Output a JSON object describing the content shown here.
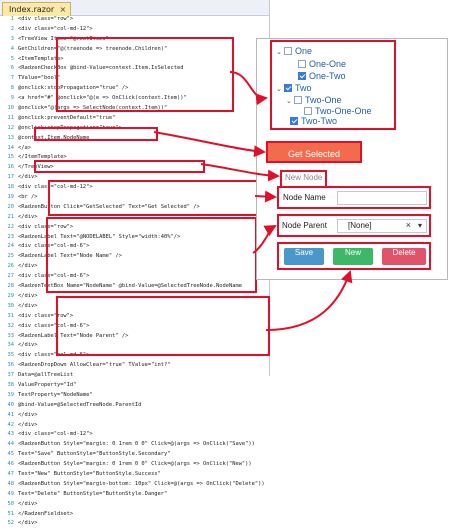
{
  "editor": {
    "tab_title": "Index.razor",
    "lines": [
      {
        "n": "1",
        "t": "<div class=\"row\">"
      },
      {
        "n": "2",
        "t": "  <div class=\"col-md-12\">"
      },
      {
        "n": "3",
        "t": "    <TreeView Items=\"@rootItems\""
      },
      {
        "n": "4",
        "t": "        GetChildren=\"@(treenode => treenode.Children)\""
      },
      {
        "n": "5",
        "t": "        <ItemTemplate>"
      },
      {
        "n": "6",
        "t": "          <RadzenCheckBox @bind-Value=context.Item.IsSelected"
      },
      {
        "n": "7",
        "t": "                          TValue=\"bool\""
      },
      {
        "n": "8",
        "t": "                          @onclick:stopPropagation=\"true\" />"
      },
      {
        "n": "9",
        "t": "          <a href=\"#\" @onclick=\"@(e => OnClick(context.Item))\""
      },
      {
        "n": "10",
        "t": "             @onclick=\"@(args => SelectNode(context.Item))\""
      },
      {
        "n": "11",
        "t": "             @onclick:preventDefault=\"true\""
      },
      {
        "n": "12",
        "t": "             @onclick:stopPropagation=\"true\">"
      },
      {
        "n": "13",
        "t": "            @context.Item.NodeName"
      },
      {
        "n": "14",
        "t": "          </a>"
      },
      {
        "n": "15",
        "t": "        </ItemTemplate>"
      },
      {
        "n": "16",
        "t": "    </TreeView>"
      },
      {
        "n": "17",
        "t": "  </div>"
      },
      {
        "n": "18",
        "t": "  <div class=\"col-md-12\">"
      },
      {
        "n": "19",
        "t": "    <br />"
      },
      {
        "n": "20",
        "t": "    <RadzenButton Click=\"GetSelected\" Text=\"Get Selected\" />"
      },
      {
        "n": "21",
        "t": "  </div>"
      },
      {
        "n": "22",
        "t": "  <div class=\"row\">"
      },
      {
        "n": "23",
        "t": "    <RadzenLabel Text=\"@NODELABEL\" Style=\"width:40%\"/>"
      },
      {
        "n": "24",
        "t": "      <div class=\"col-md-6\">"
      },
      {
        "n": "25",
        "t": "        <RadzenLabel Text=\"Node Name\" />"
      },
      {
        "n": "26",
        "t": "      </div>"
      },
      {
        "n": "27",
        "t": "      <div class=\"col-md-6\">"
      },
      {
        "n": "28",
        "t": "        <RadzenTextBox Name=\"NodeName\" @bind-Value=@SelectedTreeNode.NodeName"
      },
      {
        "n": "29",
        "t": "      </div>"
      },
      {
        "n": "30",
        "t": "    </div>"
      },
      {
        "n": "31",
        "t": "    <div class=\"row\">"
      },
      {
        "n": "32",
        "t": "      <div class=\"col-md-6\">"
      },
      {
        "n": "33",
        "t": "        <RadzenLabel Text=\"Node Parent\" />"
      },
      {
        "n": "34",
        "t": "      </div>"
      },
      {
        "n": "35",
        "t": "      <div class=\"col-md-6\">"
      },
      {
        "n": "36",
        "t": "        <RadzenDropDown AllowClear=\"true\" TValue=\"int?\""
      },
      {
        "n": "37",
        "t": "                        Data=@allTreeList"
      },
      {
        "n": "38",
        "t": "                        ValueProperty=\"Id\""
      },
      {
        "n": "39",
        "t": "                        TextProperty=\"NodeName\""
      },
      {
        "n": "40",
        "t": "                        @bind-Value=@SelectedTreeNode.ParentId"
      },
      {
        "n": "41",
        "t": "      </div>"
      },
      {
        "n": "42",
        "t": "    </div>"
      },
      {
        "n": "43",
        "t": "    <div class=\"col-md-12\">"
      },
      {
        "n": "44",
        "t": "      <RadzenButton Style=\"margin: 0 1rem 0 0\" Click=@(args => OnClick(\"Save\"))"
      },
      {
        "n": "45",
        "t": "                    Text=\"Save\" ButtonStyle=\"ButtonStyle.Secondary\""
      },
      {
        "n": "46",
        "t": "      <RadzenButton Style=\"margin: 0 1rem 0 0\" Click=@(args => OnClick(\"New\"))"
      },
      {
        "n": "47",
        "t": "                    Text=\"New\" ButtonStyle=\"ButtonStyle.Success\""
      },
      {
        "n": "48",
        "t": "      <RadzenButton Style=\"margin-bottom: 10px\" Click=@(args => OnClick(\"Delete\"))"
      },
      {
        "n": "49",
        "t": "                    Text=\"Delete\" ButtonStyle=\"ButtonStyle.Danger\""
      },
      {
        "n": "50",
        "t": "    </div>"
      },
      {
        "n": "51",
        "t": "  </RadzenFieldset>"
      },
      {
        "n": "52",
        "t": "</div>"
      }
    ]
  },
  "tree": {
    "nodes": [
      {
        "label": "One",
        "checked": false,
        "chevron": "⌄"
      },
      {
        "label": "One-One",
        "checked": false,
        "chevron": ""
      },
      {
        "label": "One-Two",
        "checked": true,
        "chevron": ""
      },
      {
        "label": "Two",
        "checked": true,
        "chevron": "⌄"
      },
      {
        "label": "Two-One",
        "checked": false,
        "chevron": "⌄"
      },
      {
        "label": "Two-One-One",
        "checked": false,
        "chevron": ""
      },
      {
        "label": "Two-Two",
        "checked": true,
        "chevron": ""
      }
    ]
  },
  "get_selected": {
    "label": "Get Selected"
  },
  "fieldset": {
    "legend": "New Node"
  },
  "node_name": {
    "label": "Node Name",
    "value": ""
  },
  "node_parent": {
    "label": "Node Parent",
    "selected": "[None]",
    "clear": "×",
    "caret": "▾"
  },
  "actions": {
    "save": "Save",
    "new": "New",
    "delete": "Delete"
  },
  "colors": {
    "highlight": "#e0102a",
    "save": "#4a98c9",
    "new": "#3cb868",
    "delete": "#e0536a",
    "get_selected": "#f26b4d",
    "checkbox_on": "#3a7bd5"
  }
}
